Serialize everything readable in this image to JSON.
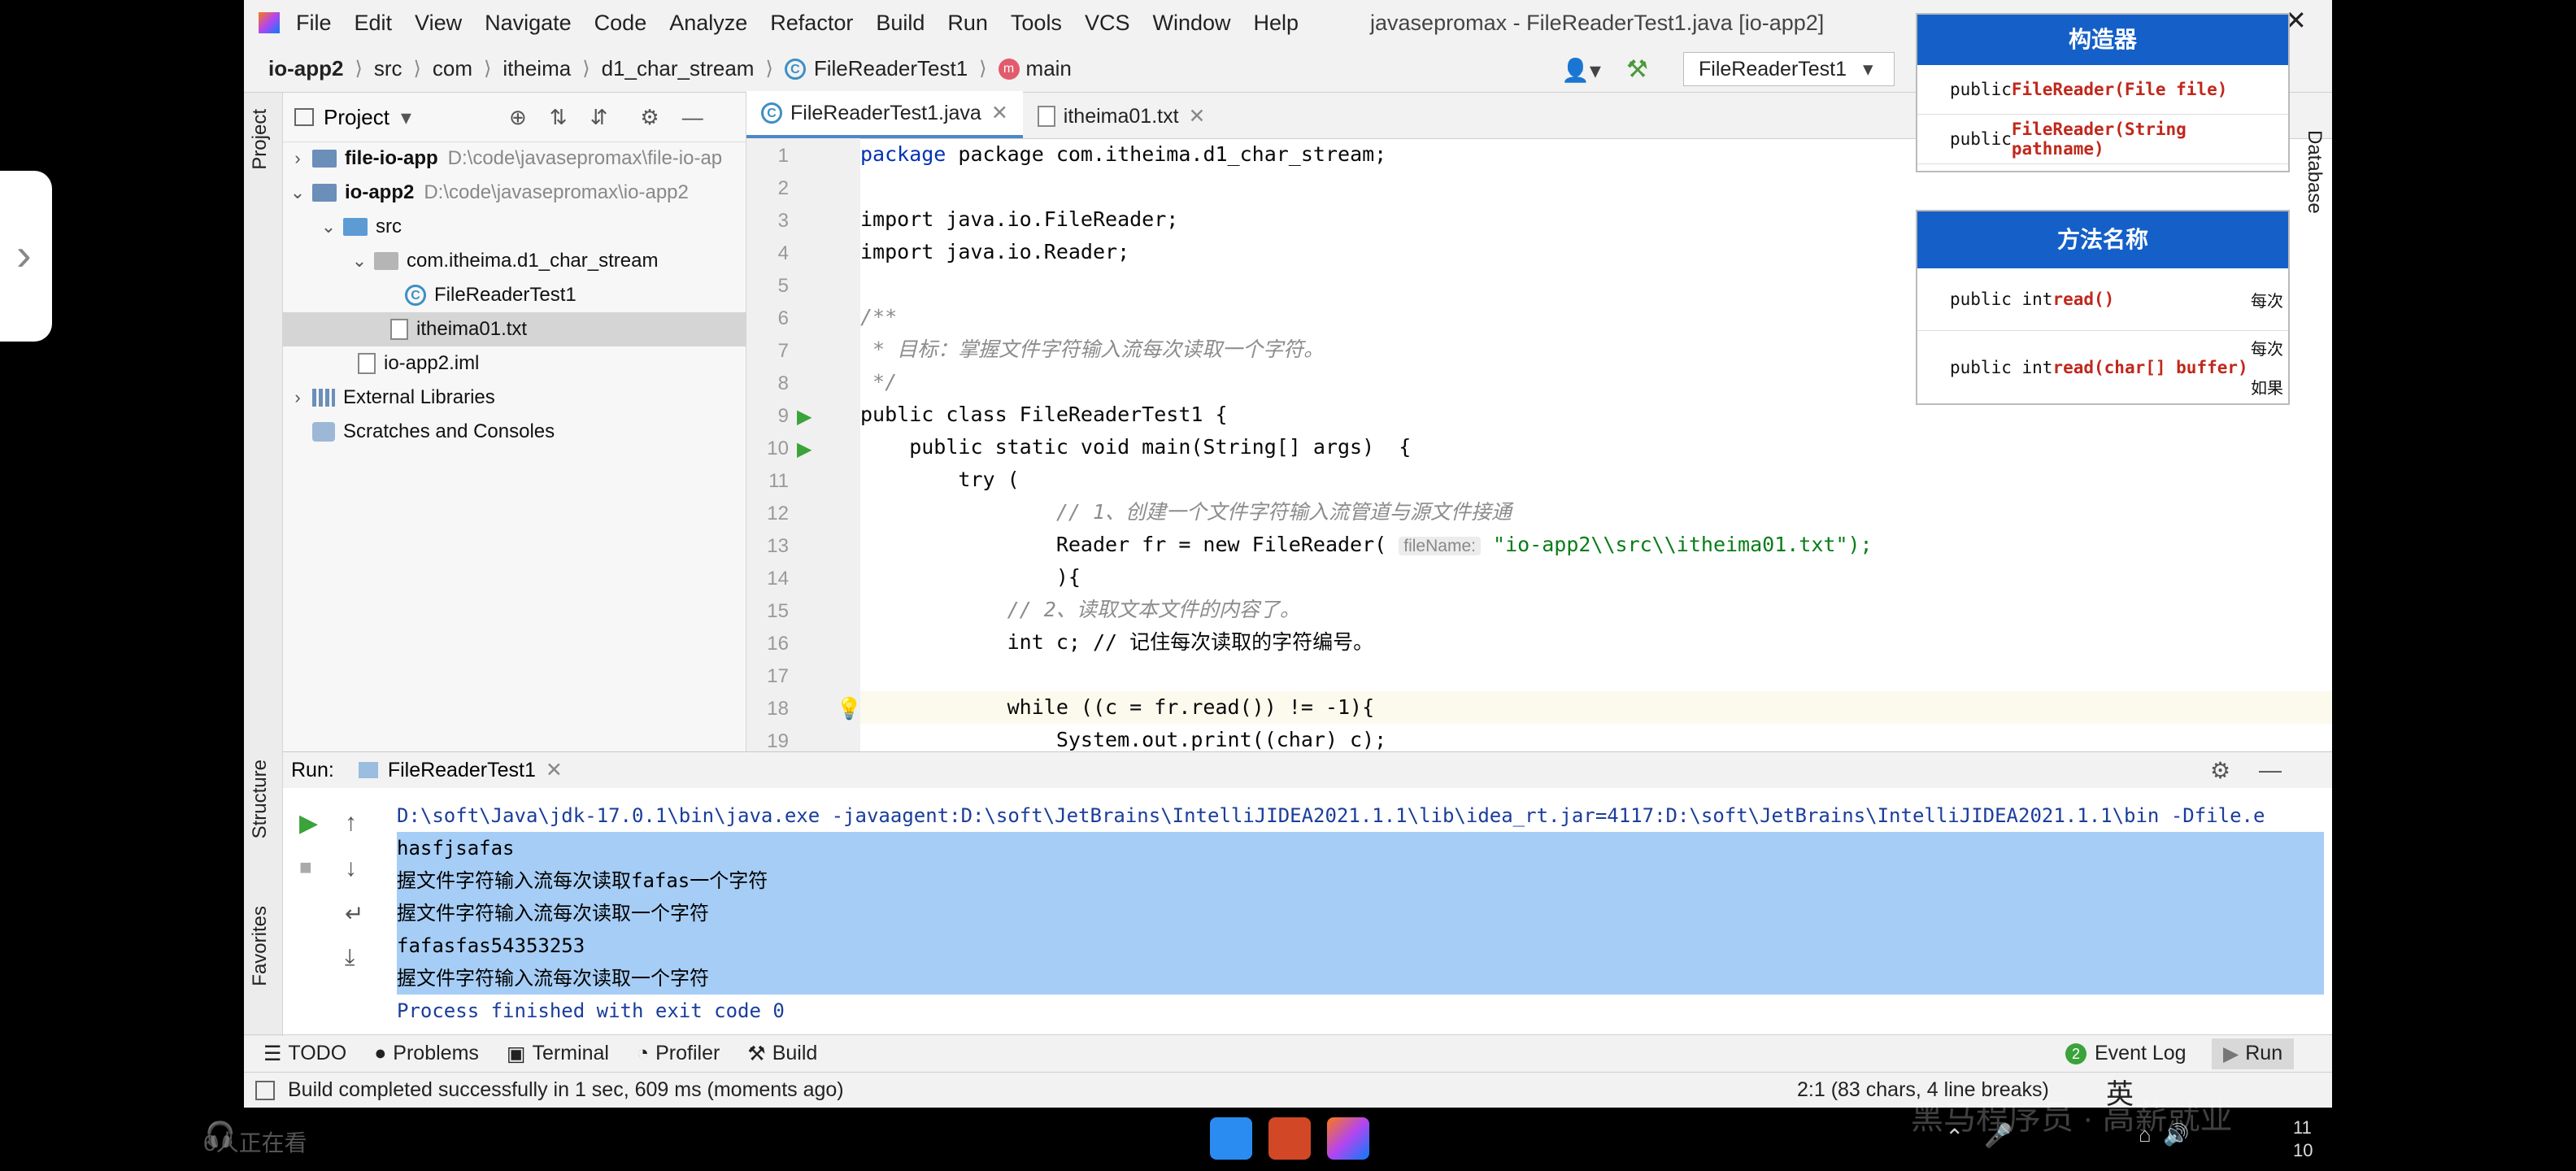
{
  "window": {
    "title": "javasepromax - FileReaderTest1.java [io-app2]"
  },
  "menu": [
    "File",
    "Edit",
    "View",
    "Navigate",
    "Code",
    "Analyze",
    "Refactor",
    "Build",
    "Run",
    "Tools",
    "VCS",
    "Window",
    "Help"
  ],
  "breadcrumb": [
    "io-app2",
    "src",
    "com",
    "itheima",
    "d1_char_stream",
    "FileReaderTest1",
    "main"
  ],
  "run_config": "FileReaderTest1",
  "project_panel": {
    "title": "Project",
    "tree": [
      {
        "label": "file-io-app",
        "path": "D:\\code\\javasepromax\\file-io-ap"
      },
      {
        "label": "io-app2",
        "path": "D:\\code\\javasepromax\\io-app2"
      },
      {
        "label": "src"
      },
      {
        "label": "com.itheima.d1_char_stream"
      },
      {
        "label": "FileReaderTest1"
      },
      {
        "label": "itheima01.txt"
      },
      {
        "label": "io-app2.iml"
      },
      {
        "label": "External Libraries"
      },
      {
        "label": "Scratches and Consoles"
      }
    ]
  },
  "editor": {
    "tabs": [
      "FileReaderTest1.java",
      "itheima01.txt"
    ],
    "line_numbers": [
      "1",
      "2",
      "3",
      "4",
      "5",
      "6",
      "7",
      "8",
      "9",
      "10",
      "11",
      "12",
      "13",
      "14",
      "15",
      "16",
      "17",
      "18",
      "19"
    ],
    "code": {
      "l1": "package com.itheima.d1_char_stream;",
      "l3": "import java.io.FileReader;",
      "l4": "import java.io.Reader;",
      "l6": "/**",
      "l7": " * 目标：掌握文件字符输入流每次读取一个字符。",
      "l8": " */",
      "l9": "public class FileReaderTest1 {",
      "l10": "    public static void main(String[] args)  {",
      "l11": "        try (",
      "l12": "                // 1、创建一个文件字符输入流管道与源文件接通",
      "l13a": "                Reader fr = new FileReader( ",
      "l13hint": "fileName:",
      "l13b": " \"io-app2\\\\src\\\\itheima01.txt\");",
      "l14": "                ){",
      "l15": "            // 2、读取文本文件的内容了。",
      "l16": "            int c; // 记住每次读取的字符编号。",
      "l17": "            while ((c = fr.read()) != -1){",
      "l18": "                System.out.print((char) c);",
      "l19": "            }"
    }
  },
  "run_panel": {
    "label": "Run:",
    "tab": "FileReaderTest1",
    "output": [
      "D:\\soft\\Java\\jdk-17.0.1\\bin\\java.exe -javaagent:D:\\soft\\JetBrains\\IntelliJIDEA2021.1.1\\lib\\idea_rt.jar=4117:D:\\soft\\JetBrains\\IntelliJIDEA2021.1.1\\bin -Dfile.e",
      "hasfjsafas",
      "握文件字符输入流每次读取fafas一个字符",
      "握文件字符输入流每次读取一个字符",
      "fafasfas54353253",
      "握文件字符输入流每次读取一个字符",
      "Process finished with exit code 0"
    ]
  },
  "bottom_tabs": [
    "TODO",
    "Problems",
    "Terminal",
    "Profiler",
    "Build"
  ],
  "event_log": "Event Log",
  "event_count": "2",
  "run_tab": "Run",
  "status": {
    "message": "Build completed successfully in 1 sec, 609 ms (moments ago)",
    "position": "2:1 (83 chars, 4 line breaks)"
  },
  "side_tabs": {
    "project": "Project",
    "structure": "Structure",
    "favorites": "Favorites",
    "database": "Database"
  },
  "overlay": {
    "constructor_header": "构造器",
    "constructors": [
      {
        "prefix": "public ",
        "name": "FileReader(File file)"
      },
      {
        "prefix": "public ",
        "name": "FileReader(String pathname)"
      }
    ],
    "method_header": "方法名称",
    "methods": [
      {
        "prefix": "public int ",
        "name": "read()",
        "note": "每次"
      },
      {
        "prefix": "public int ",
        "name": "read(char[] buffer)",
        "note": "每次",
        "note2": "如果"
      }
    ]
  },
  "viewers": "6人正在看",
  "tray": {
    "ime": "英",
    "time": "11",
    "date": "10"
  },
  "watermark": "黑马程序员 · 高薪就业",
  "colors": {
    "accent": "#1560c8",
    "selection": "#a6cdf5",
    "keyword": "#0033b3",
    "comment": "#8c8c8c",
    "string": "#067d17"
  }
}
